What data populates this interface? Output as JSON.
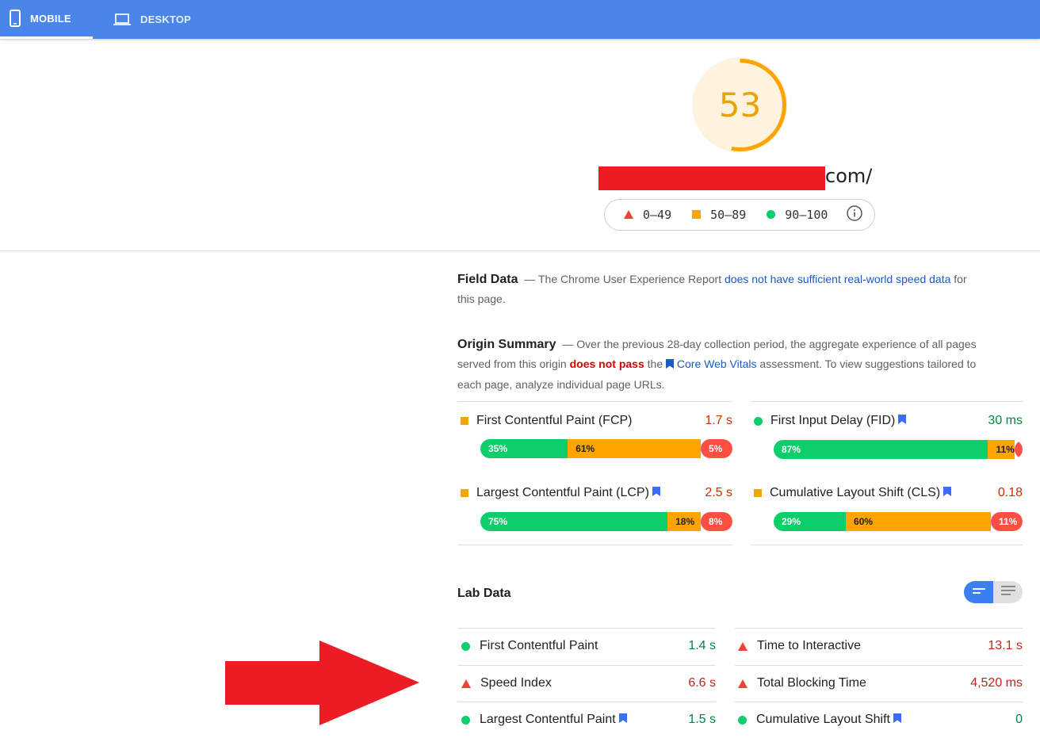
{
  "tabs": [
    {
      "label": "MOBILE",
      "icon": "phone-icon",
      "active": true
    },
    {
      "label": "DESKTOP",
      "icon": "laptop-icon",
      "active": false
    }
  ],
  "score": {
    "value": "53",
    "fraction": 0.53,
    "color": "#ffa400"
  },
  "url": {
    "suffix": "com/"
  },
  "legend": {
    "ranges": [
      {
        "label": "0–49",
        "icon": "triangle-icon",
        "color": "#eb4334"
      },
      {
        "label": "50–89",
        "icon": "square-icon",
        "color": "#ffa400"
      },
      {
        "label": "90–100",
        "icon": "circle-icon",
        "color": "#0cce6b"
      }
    ]
  },
  "field_data": {
    "title": "Field Data",
    "dash": "—",
    "text1": "The Chrome User Experience Report",
    "link": "does not have sufficient real-world speed data",
    "text2": "for this page."
  },
  "origin_summary": {
    "title": "Origin Summary",
    "dash": "—",
    "text1": "Over the previous 28-day collection period, the aggregate experience of all pages served from this origin",
    "fail": "does not pass",
    "text2": "the",
    "link": "Core Web Vitals",
    "text3": "assessment. To view suggestions tailored to each page, analyze individual page URLs.",
    "metrics": [
      {
        "name": "First Contentful Paint (FCP)",
        "value": "1.7 s",
        "status": "average",
        "bookmark": false,
        "dist": [
          {
            "pct": 35,
            "label": "35%"
          },
          {
            "pct": 61,
            "label": "61%"
          },
          {
            "pct": 5,
            "label": "5%"
          }
        ]
      },
      {
        "name": "First Input Delay (FID)",
        "value": "30 ms",
        "status": "good",
        "bookmark": true,
        "dist": [
          {
            "pct": 87,
            "label": "87%"
          },
          {
            "pct": 11,
            "label": "11%"
          },
          {
            "pct": 3,
            "label": "3%"
          }
        ]
      },
      {
        "name": "Largest Contentful Paint (LCP)",
        "value": "2.5 s",
        "status": "average",
        "bookmark": true,
        "dist": [
          {
            "pct": 75,
            "label": "75%"
          },
          {
            "pct": 18,
            "label": "18%"
          },
          {
            "pct": 8,
            "label": "8%"
          }
        ]
      },
      {
        "name": "Cumulative Layout Shift (CLS)",
        "value": "0.18",
        "status": "average",
        "bookmark": true,
        "dist": [
          {
            "pct": 29,
            "label": "29%"
          },
          {
            "pct": 60,
            "label": "60%"
          },
          {
            "pct": 11,
            "label": "11%"
          }
        ]
      }
    ]
  },
  "lab_data": {
    "title": "Lab Data",
    "metrics": [
      {
        "name": "First Contentful Paint",
        "value": "1.4 s",
        "status": "good",
        "bookmark": false
      },
      {
        "name": "Time to Interactive",
        "value": "13.1 s",
        "status": "poor",
        "bookmark": false
      },
      {
        "name": "Speed Index",
        "value": "6.6 s",
        "status": "poor",
        "bookmark": false
      },
      {
        "name": "Total Blocking Time",
        "value": "4,520 ms",
        "status": "poor",
        "bookmark": false
      },
      {
        "name": "Largest Contentful Paint",
        "value": "1.5 s",
        "status": "good",
        "bookmark": true
      },
      {
        "name": "Cumulative Layout Shift",
        "value": "0",
        "status": "good",
        "bookmark": true
      }
    ]
  },
  "colors": {
    "good": "#0cce6b",
    "average": "#ffa400",
    "poor": "#eb4334",
    "good_text": "#018642",
    "average_text": "#c33300",
    "poor_text": "#c7221f",
    "accent": "#4a86e8",
    "redaction": "#ec1c24"
  }
}
